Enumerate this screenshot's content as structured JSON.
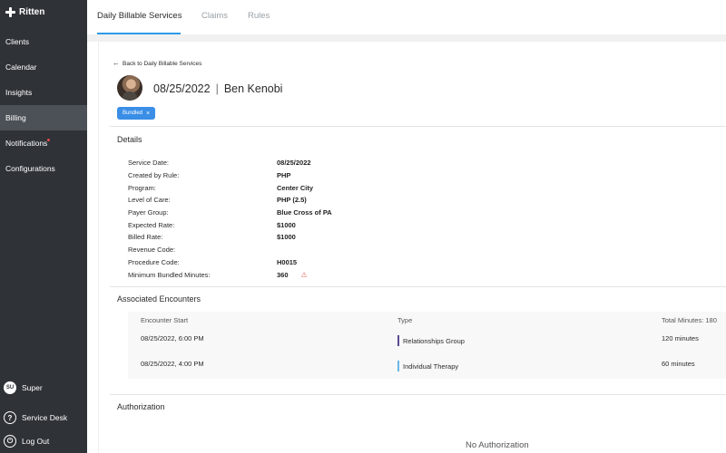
{
  "brand": {
    "name": "Ritten"
  },
  "sidebar": {
    "items": [
      {
        "label": "Clients",
        "active": false
      },
      {
        "label": "Calendar",
        "active": false
      },
      {
        "label": "Insights",
        "active": false
      },
      {
        "label": "Billing",
        "active": true
      },
      {
        "label": "Notifications",
        "active": false
      },
      {
        "label": "Configurations",
        "active": false
      }
    ],
    "user": {
      "initials": "SU",
      "name": "Super"
    },
    "service_desk": "Service Desk",
    "logout": "Log Out"
  },
  "tabs": [
    {
      "label": "Daily Billable Services",
      "active": true
    },
    {
      "label": "Claims",
      "active": false
    },
    {
      "label": "Rules",
      "active": false
    }
  ],
  "back_link": "Back to Daily Billable Services",
  "header": {
    "date": "08/25/2022",
    "separator": "|",
    "name": "Ben Kenobi"
  },
  "chip": {
    "label": "Bundled",
    "close": "×"
  },
  "details": {
    "title": "Details",
    "rows": [
      {
        "label": "Service Date:",
        "value": "08/25/2022"
      },
      {
        "label": "Created by Rule:",
        "value": "PHP"
      },
      {
        "label": "Program:",
        "value": "Center City"
      },
      {
        "label": "Level of Care:",
        "value": "PHP (2.5)"
      },
      {
        "label": "Payer Group:",
        "value": "Blue Cross of PA"
      },
      {
        "label": "Expected Rate:",
        "value": "$1000"
      },
      {
        "label": "Billed Rate:",
        "value": "$1000"
      },
      {
        "label": "Revenue Code:",
        "value": ""
      },
      {
        "label": "Procedure Code:",
        "value": "H0015"
      },
      {
        "label": "Minimum Bundled Minutes:",
        "value": "360"
      }
    ]
  },
  "encounters": {
    "title": "Associated Encounters",
    "columns": {
      "start": "Encounter Start",
      "type": "Type",
      "total": "Total Minutes: 180"
    },
    "rows": [
      {
        "start": "08/25/2022, 6:00 PM",
        "type": "Relationships Group",
        "minutes": "120 minutes",
        "color": "#5b4a8f"
      },
      {
        "start": "08/25/2022, 4:00 PM",
        "type": "Individual Therapy",
        "minutes": "60 minutes",
        "color": "#6bb6e6"
      }
    ]
  },
  "authorization": {
    "title": "Authorization",
    "empty": "No Authorization"
  },
  "colors": {
    "sidebar": "#2f3338",
    "accent": "#3a8ee6",
    "tab_underline": "#2f9be9",
    "warning": "#e26a6a"
  },
  "icons": {
    "warning": "warning-triangle-icon",
    "back": "arrow-left-icon",
    "help": "help-circle-icon",
    "logout": "logout-icon"
  }
}
